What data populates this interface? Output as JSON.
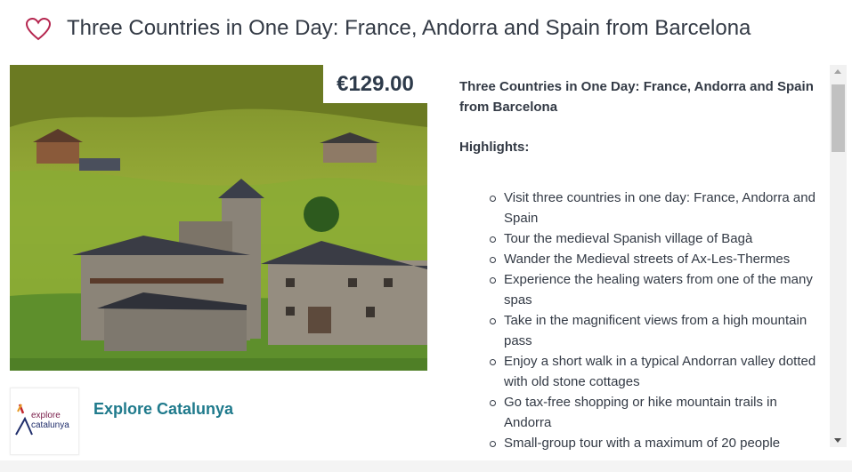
{
  "header": {
    "title": "Three Countries in One Day: France, Andorra and Spain from Barcelona",
    "heart_color": "#b5264f"
  },
  "tour": {
    "price": "€129.00",
    "description_title": "Three Countries in One Day: France, Andorra and Spain from Barcelona",
    "highlights_label": "Highlights:",
    "highlights": [
      "Visit three countries in one day: France, Andorra and Spain",
      "Tour the medieval Spanish village of Bagà",
      "Wander the Medieval streets of Ax-Les-Thermes",
      "Experience the healing waters from one of the many spas",
      "Take in the magnificent views from a high mountain pass",
      "Enjoy a short walk in a typical Andorran valley dotted with old stone cottages",
      "Go tax-free shopping or hike mountain trails in Andorra",
      "Small-group tour with a maximum of 20 people"
    ]
  },
  "supplier": {
    "name": "Explore Catalunya",
    "logo_line1": "explore",
    "logo_line2": "catalunya"
  },
  "colors": {
    "accent": "#1f7a8c",
    "price_text": "#2d3a4a",
    "title_text": "#333a45"
  }
}
